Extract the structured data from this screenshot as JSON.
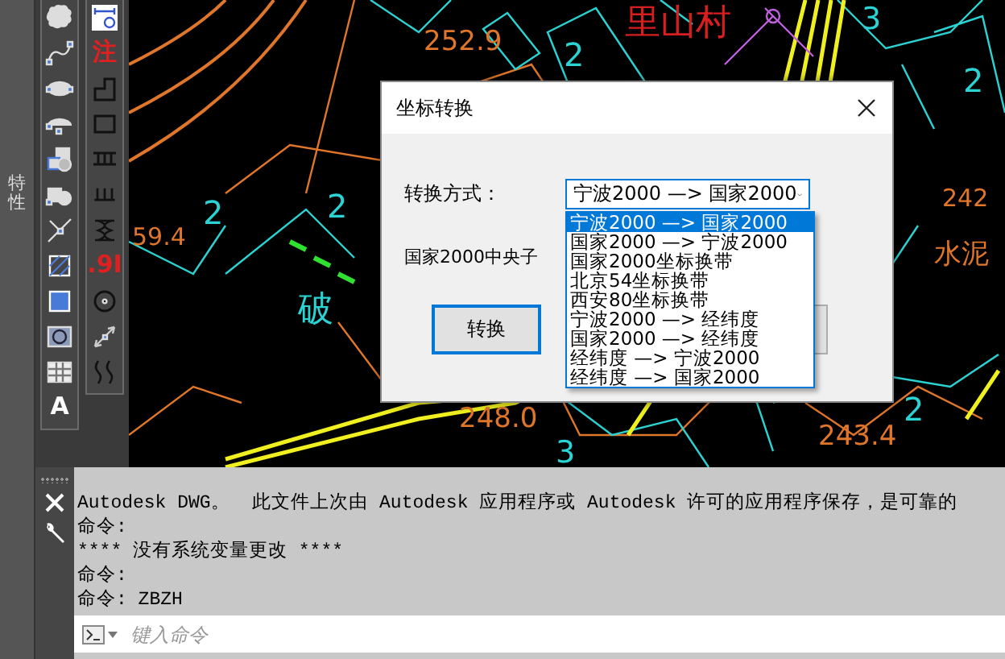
{
  "side_panel": {
    "label": "特性"
  },
  "toolbars": [
    {
      "items": [
        {
          "kind": "cloud"
        },
        {
          "kind": "spline"
        },
        {
          "kind": "ellipse"
        },
        {
          "kind": "ellipse-arc"
        },
        {
          "kind": "block-insert"
        },
        {
          "kind": "block-make"
        },
        {
          "kind": "point"
        },
        {
          "kind": "hatch"
        },
        {
          "kind": "gradient"
        },
        {
          "kind": "region"
        },
        {
          "kind": "table"
        },
        {
          "kind": "glyph",
          "label": "A",
          "color": "#ffffff"
        }
      ]
    },
    {
      "items": [
        {
          "kind": "measure"
        },
        {
          "kind": "glyph",
          "label": "注",
          "color": "#e02020"
        },
        {
          "kind": "step"
        },
        {
          "kind": "rectangle"
        },
        {
          "kind": "ladder"
        },
        {
          "kind": "comb"
        },
        {
          "kind": "coil"
        },
        {
          "kind": "glyph",
          "label": ".9I",
          "color": "#e02020"
        },
        {
          "kind": "circle-dot"
        },
        {
          "kind": "dimension"
        },
        {
          "kind": "wave"
        }
      ]
    }
  ],
  "canvas_labels": [
    {
      "text": "252.9",
      "color": "#e0762a"
    },
    {
      "text": "里山村",
      "color": "#d81e1e"
    },
    {
      "text": "3",
      "color": "#2ad4d4"
    },
    {
      "text": "2",
      "color": "#2ad4d4"
    },
    {
      "text": "2",
      "color": "#2ad4d4"
    },
    {
      "text": "2",
      "color": "#2ad4d4"
    },
    {
      "text": "2",
      "color": "#2ad4d4"
    },
    {
      "text": "59.4",
      "color": "#e0762a"
    },
    {
      "text": "破",
      "color": "#2ad4d4"
    },
    {
      "text": "242",
      "color": "#e0762a"
    },
    {
      "text": "水泥",
      "color": "#e0762a"
    },
    {
      "text": "248.0",
      "color": "#e0762a"
    },
    {
      "text": "3",
      "color": "#2ad4d4"
    },
    {
      "text": "2",
      "color": "#2ad4d4"
    },
    {
      "text": "243.4",
      "color": "#e0762a"
    }
  ],
  "dialog": {
    "title": "坐标转换",
    "method_label": "转换方式：",
    "method_value": "宁波2000  —> 国家2000",
    "options": [
      {
        "label": "宁波2000  —> 国家2000",
        "selected": true
      },
      {
        "label": "国家2000  —> 宁波2000",
        "selected": false
      },
      {
        "label": "国家2000坐标换带",
        "selected": false
      },
      {
        "label": "北京54坐标换带",
        "selected": false
      },
      {
        "label": "西安80坐标换带",
        "selected": false
      },
      {
        "label": "宁波2000  —> 经纬度",
        "selected": false
      },
      {
        "label": "国家2000  —> 经纬度",
        "selected": false
      },
      {
        "label": "经纬度  —> 宁波2000",
        "selected": false
      },
      {
        "label": "经纬度  —> 国家2000",
        "selected": false
      }
    ],
    "meridian_label": "国家2000中央子",
    "convert_button": "转换"
  },
  "command_history": [
    "Autodesk DWG。  此文件上次由 Autodesk 应用程序或 Autodesk 许可的应用程序保存，是可靠的",
    "命令:",
    "**** 没有系统变量更改 ****",
    "命令:",
    "命令: ZBZH"
  ],
  "command_input": {
    "placeholder": "键入命令"
  }
}
